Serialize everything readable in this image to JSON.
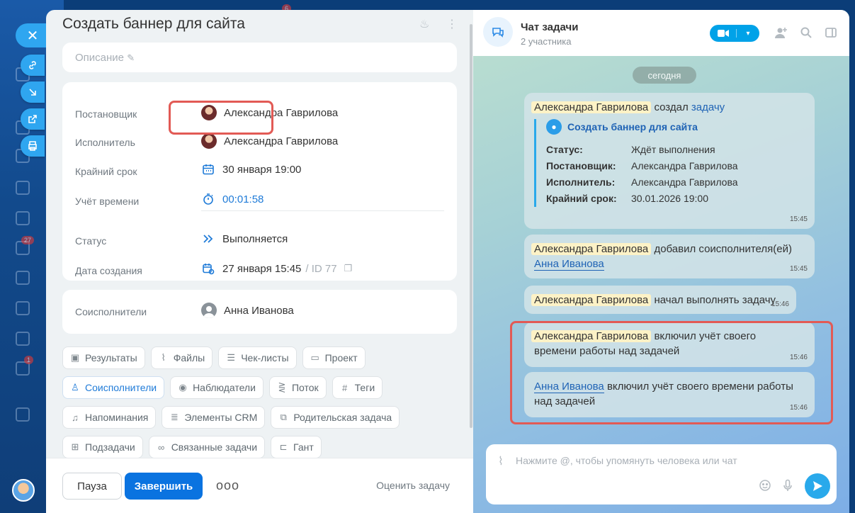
{
  "colors": {
    "accent": "#0a73e0",
    "highlight": "#e25a55",
    "link": "#1f63b5"
  },
  "background": {
    "badges": [
      "6",
      "27",
      "1"
    ]
  },
  "task": {
    "title": "Создать баннер для сайта",
    "description_placeholder": "Описание",
    "fields": [
      {
        "label": "Постановщик",
        "value": "Александра Гаврилова",
        "icon": "avatar"
      },
      {
        "label": "Исполнитель",
        "value": "Александра Гаврилова",
        "icon": "avatar"
      },
      {
        "label": "Крайний срок",
        "value": "30 января 19:00",
        "icon": "calendar-icon"
      },
      {
        "label": "Учёт времени",
        "value": "00:01:58",
        "icon": "stopwatch-icon"
      },
      {
        "label": "Статус",
        "value": "Выполняется",
        "icon": "play-status-icon"
      },
      {
        "label": "Дата создания",
        "value": "27 января 15:45",
        "icon": "calendar-clock-icon",
        "extra": "/ ID 77"
      }
    ],
    "coexecutors_label": "Соисполнители",
    "coexecutor": "Анна Иванова",
    "tags": [
      [
        "Результаты",
        "Файлы",
        "Чек-листы",
        "Проект"
      ],
      [
        "Соисполнители",
        "Наблюдатели",
        "Поток",
        "Теги"
      ],
      [
        "Напоминания",
        "Элементы CRM",
        "Родительская задача"
      ],
      [
        "Подзадачи",
        "Связанные задачи",
        "Гант"
      ]
    ],
    "footer": {
      "pause": "Пауза",
      "finish": "Завершить",
      "more": "ооо",
      "rate": "Оценить задачу"
    }
  },
  "chat": {
    "title": "Чат задачи",
    "subtitle": "2 участника",
    "day": "сегодня",
    "m1": {
      "name": "Александра Гаврилова",
      "text": "создал",
      "link": "задачу",
      "card_title": "Создать баннер для сайта",
      "rows": [
        [
          "Статус:",
          "Ждёт выполнения"
        ],
        [
          "Постановщик:",
          "Александра Гаврилова"
        ],
        [
          "Исполнитель:",
          "Александра Гаврилова"
        ],
        [
          "Крайний срок:",
          "30.01.2026 19:00"
        ]
      ],
      "time": "15:45"
    },
    "m2": {
      "name": "Александра Гаврилова",
      "text": "добавил соисполнителя(ей)",
      "link": "Анна Иванова",
      "time": "15:45"
    },
    "m3": {
      "name": "Александра Гаврилова",
      "text": "начал выполнять задачу",
      "time": "15:46"
    },
    "m4": {
      "name": "Александра Гаврилова",
      "text1": "включил учёт своего",
      "text2": "времени работы над задачей",
      "time": "15:46"
    },
    "m5": {
      "name": "Анна Иванова",
      "text1": "включил учёт своего времени работы",
      "text2": "над задачей",
      "time": "15:46"
    },
    "input_placeholder": "Нажмите @, чтобы упомянуть человека или чат"
  }
}
